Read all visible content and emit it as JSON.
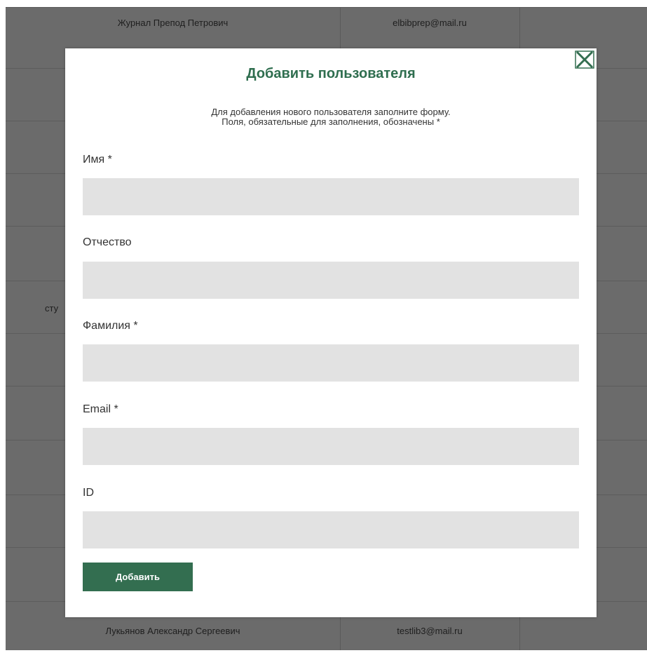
{
  "background_table": {
    "top_row": {
      "name": "Журнал Препод Петрович",
      "email": "elbibprep@mail.ru"
    },
    "bottom_row": {
      "name": "Лукьянов Александр Сергеевич",
      "email": "testlib3@mail.ru"
    },
    "partial_text": "сту"
  },
  "modal": {
    "title": "Добавить пользователя",
    "description_line1": "Для добавления нового пользователя заполните форму.",
    "description_line2": "Поля, обязательные для заполнения, обозначены *",
    "close_icon": "close-x-icon",
    "fields": [
      {
        "label": "Имя *",
        "value": ""
      },
      {
        "label": "Отчество",
        "value": ""
      },
      {
        "label": "Фамилия *",
        "value": ""
      },
      {
        "label": "Email *",
        "value": ""
      },
      {
        "label": "ID",
        "value": ""
      }
    ],
    "submit_label": "Добавить"
  },
  "colors": {
    "accent": "#336e50",
    "title": "#2f6e4f",
    "overlay_table": "#6b6b6b",
    "input_bg": "#e2e2e2"
  }
}
